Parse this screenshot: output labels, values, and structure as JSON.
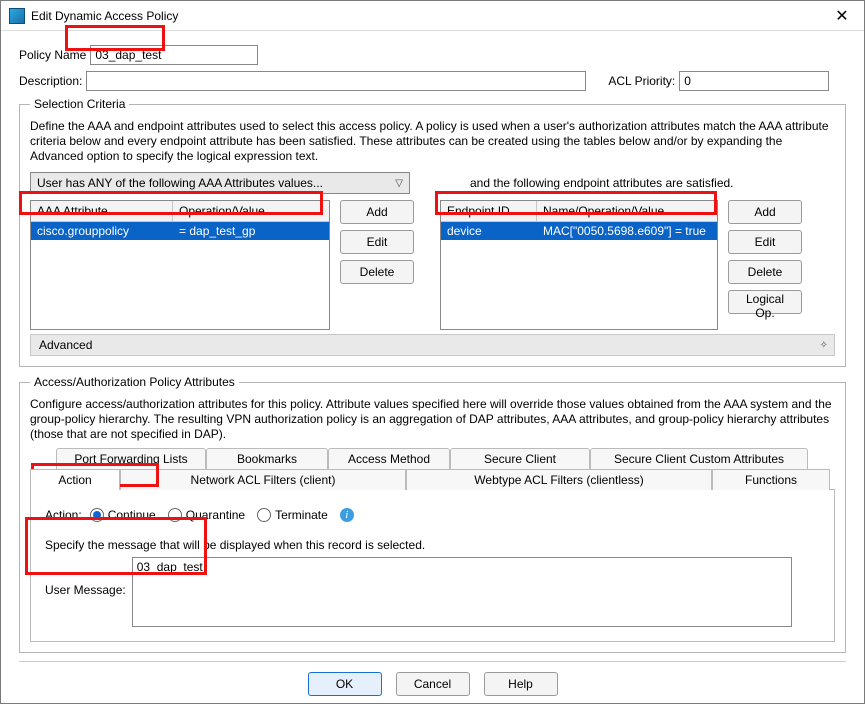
{
  "title": "Edit Dynamic Access Policy",
  "topfields": {
    "policy_name_lbl": "Policy Name",
    "policy_name_val": "03_dap_test",
    "description_lbl": "Description:",
    "description_val": "",
    "acl_priority_lbl": "ACL Priority:",
    "acl_priority_val": "0"
  },
  "selcrit": {
    "legend": "Selection Criteria",
    "blurb": "Define the AAA and endpoint attributes used to select this access policy. A policy is used when a user's authorization attributes match the AAA attribute criteria below and every endpoint attribute has been satisfied. These attributes can be created using the tables below and/or by expanding the Advanced option to specify the logical expression text.",
    "combo": "User has ANY of the following AAA Attributes values...",
    "rightlabel": "and the following endpoint attributes are satisfied.",
    "aaa_h1": "AAA Attribute",
    "aaa_h2": "Operation/Value",
    "aaa_r1c1": "cisco.grouppolicy",
    "aaa_r1c2": "=   dap_test_gp",
    "ep_h1": "Endpoint ID",
    "ep_h2": "Name/Operation/Value",
    "ep_r1c1": "device",
    "ep_r1c2": "MAC[\"0050.5698.e609\"]   =   true",
    "btn_add": "Add",
    "btn_edit": "Edit",
    "btn_delete": "Delete",
    "btn_logical": "Logical Op.",
    "advanced": "Advanced"
  },
  "auth": {
    "legend": "Access/Authorization Policy Attributes",
    "blurb": "Configure access/authorization attributes for this policy. Attribute values specified here will override those values obtained from the AAA system and the group-policy hierarchy. The resulting VPN authorization policy is an aggregation of DAP attributes, AAA attributes, and group-policy hierarchy attributes (those that are not specified in DAP).",
    "tabs_top": {
      "pf": "Port Forwarding Lists",
      "bm": "Bookmarks",
      "am": "Access Method",
      "sc": "Secure Client",
      "scca": "Secure Client Custom Attributes"
    },
    "tabs_bot": {
      "action": "Action",
      "nacl": "Network ACL Filters (client)",
      "wacl": "Webtype ACL Filters (clientless)",
      "func": "Functions"
    },
    "action_lbl": "Action:",
    "r_continue": "Continue",
    "r_quarantine": "Quarantine",
    "r_terminate": "Terminate",
    "msg_hint": "Specify the message that will be displayed when this record is selected.",
    "msg_lbl": "User Message:",
    "msg_val": "03_dap_test"
  },
  "footer": {
    "ok": "OK",
    "cancel": "Cancel",
    "help": "Help"
  }
}
